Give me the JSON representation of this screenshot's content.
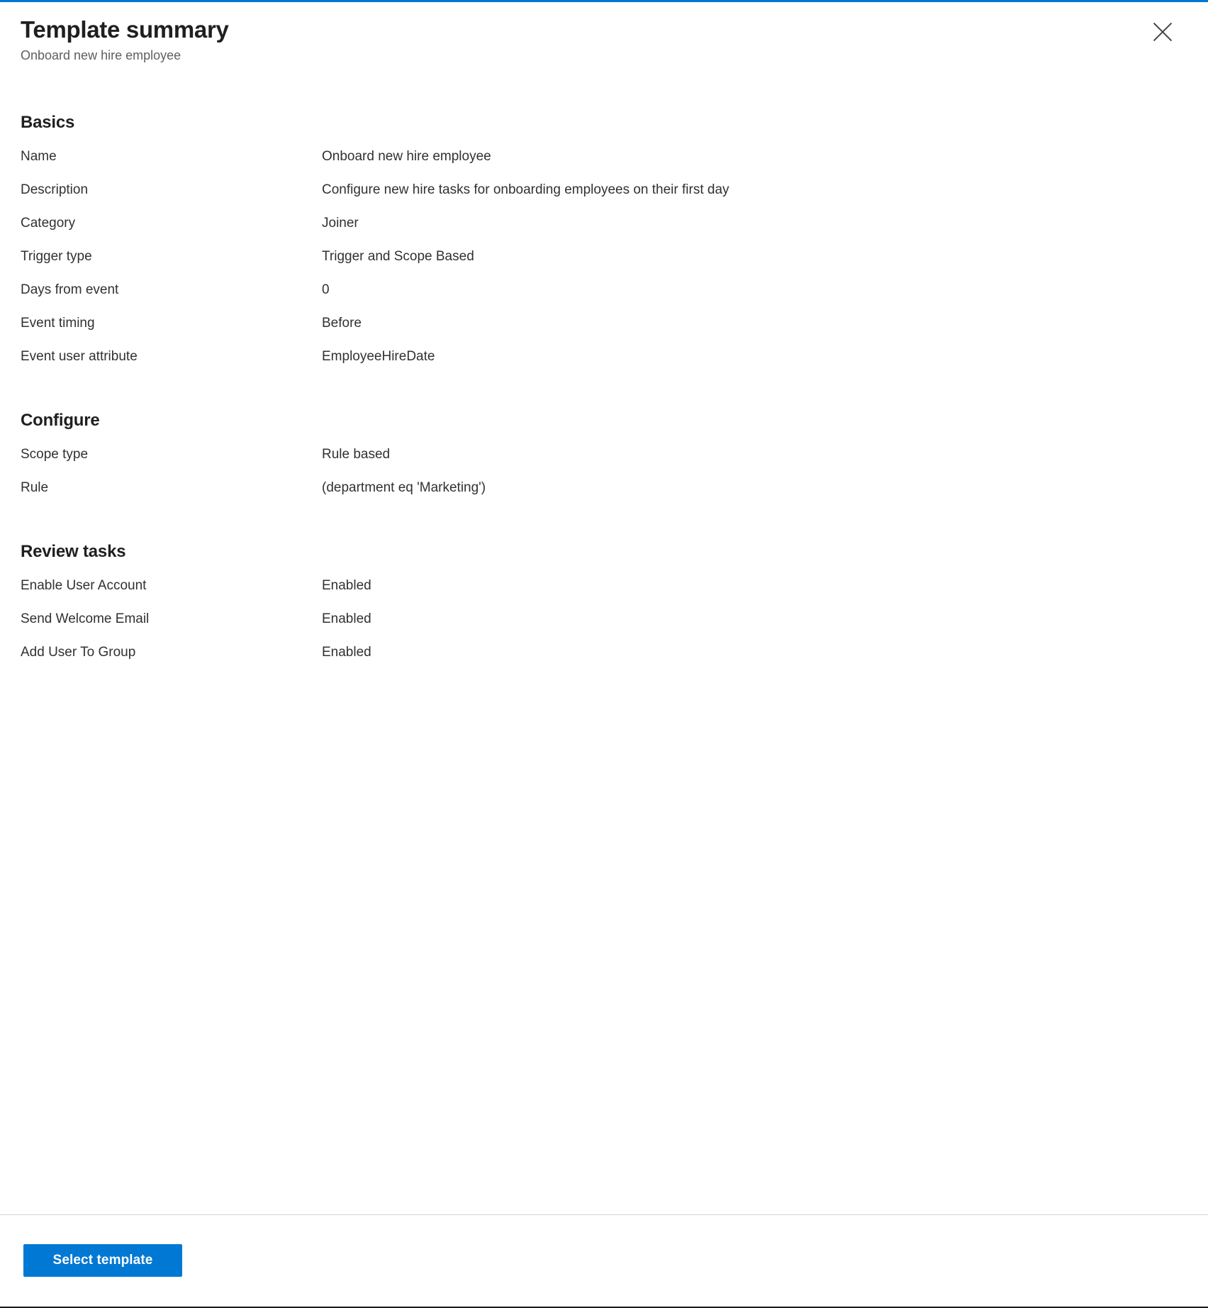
{
  "panel": {
    "title": "Template summary",
    "subtitle": "Onboard new hire employee",
    "close_icon": "close-icon",
    "accent_color": "#0078d4",
    "divider_color": "#d6d6d6"
  },
  "sections": [
    {
      "heading": "Basics",
      "rows": [
        {
          "label": "Name",
          "value": "Onboard new hire employee"
        },
        {
          "label": "Description",
          "value": "Configure new hire tasks for onboarding employees on their first day"
        },
        {
          "label": "Category",
          "value": "Joiner"
        },
        {
          "label": "Trigger type",
          "value": "Trigger and Scope Based"
        },
        {
          "label": "Days from event",
          "value": "0"
        },
        {
          "label": "Event timing",
          "value": "Before"
        },
        {
          "label": "Event user attribute",
          "value": "EmployeeHireDate"
        }
      ]
    },
    {
      "heading": "Configure",
      "rows": [
        {
          "label": "Scope type",
          "value": "Rule based"
        },
        {
          "label": "Rule",
          "value": "(department eq 'Marketing')"
        }
      ]
    },
    {
      "heading": "Review tasks",
      "rows": [
        {
          "label": "Enable User Account",
          "value": "Enabled"
        },
        {
          "label": "Send Welcome Email",
          "value": "Enabled"
        },
        {
          "label": "Add User To Group",
          "value": "Enabled"
        }
      ]
    }
  ],
  "footer": {
    "select_template_label": "Select template",
    "button_color": "#0078d4"
  }
}
